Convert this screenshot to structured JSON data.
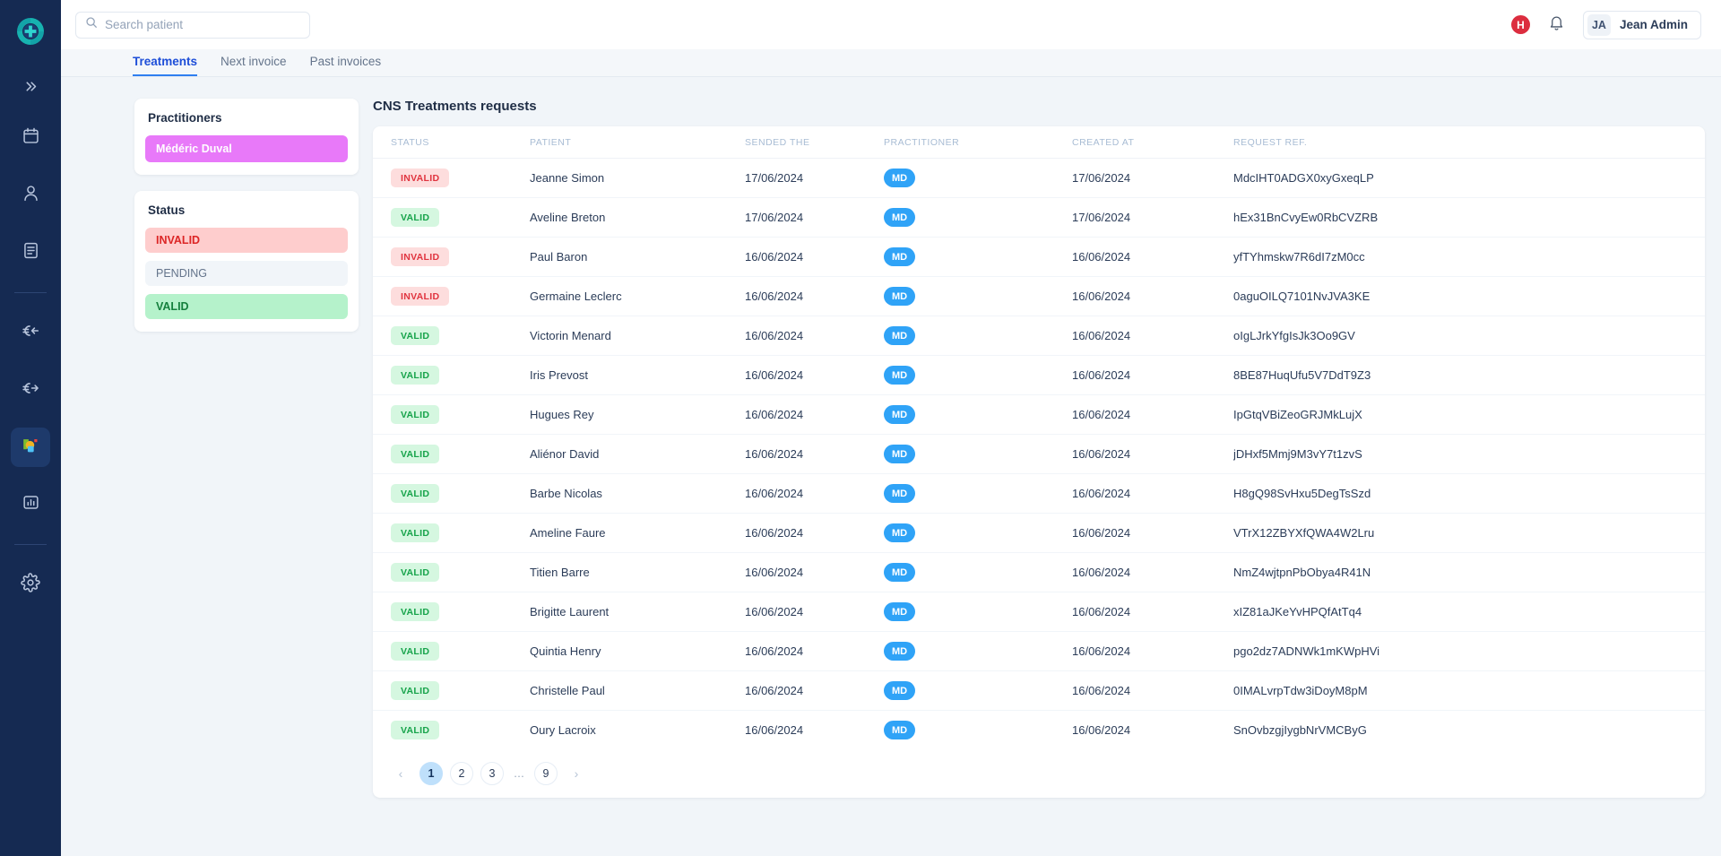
{
  "brand": {
    "logo_icon": "medical-cross-target-logo",
    "sidebar_bg": "#152a52"
  },
  "rail": {
    "collapse_icon": "double-chevron-right-icon",
    "items": [
      {
        "icon": "calendar-icon",
        "active": false
      },
      {
        "icon": "user-icon",
        "active": false
      },
      {
        "icon": "document-icon",
        "active": false
      },
      {
        "icon": "euro-incoming-icon",
        "active": false
      },
      {
        "icon": "euro-outgoing-icon",
        "active": false
      },
      {
        "icon": "cns-app-icon",
        "active": true
      },
      {
        "icon": "bar-chart-icon",
        "active": false
      },
      {
        "icon": "gear-icon",
        "active": false
      }
    ]
  },
  "topbar": {
    "search_placeholder": "Search patient",
    "search_value": "",
    "search_icon": "search-icon",
    "alert_count": "H",
    "bell_icon": "bell-icon",
    "user_initials": "JA",
    "user_name": "Jean Admin"
  },
  "tabs": [
    {
      "label": "Treatments",
      "active": true
    },
    {
      "label": "Next invoice",
      "active": false
    },
    {
      "label": "Past invoices",
      "active": false
    }
  ],
  "filters": {
    "practitioners_title": "Practitioners",
    "practitioners": [
      {
        "label": "Médéric Duval",
        "color": "#e879f9",
        "selected": true
      }
    ],
    "status_title": "Status",
    "statuses": [
      {
        "label": "INVALID",
        "color": "#fecdcd",
        "selected": true
      },
      {
        "label": "PENDING",
        "color": "#f1f5f9",
        "selected": false
      },
      {
        "label": "VALID",
        "color": "#b5f2cb",
        "selected": true
      }
    ]
  },
  "panel": {
    "title": "CNS Treatments requests",
    "columns": [
      "STATUS",
      "PATIENT",
      "SENDED THE",
      "PRACTITIONER",
      "CREATED AT",
      "REQUEST REF."
    ],
    "rows": [
      {
        "status": "INVALID",
        "patient": "Jeanne Simon",
        "sended_the": "17/06/2024",
        "practitioner": "MD",
        "created_at": "17/06/2024",
        "request_ref": "MdcIHT0ADGX0xyGxeqLP"
      },
      {
        "status": "VALID",
        "patient": "Aveline Breton",
        "sended_the": "17/06/2024",
        "practitioner": "MD",
        "created_at": "17/06/2024",
        "request_ref": "hEx31BnCvyEw0RbCVZRB"
      },
      {
        "status": "INVALID",
        "patient": "Paul Baron",
        "sended_the": "16/06/2024",
        "practitioner": "MD",
        "created_at": "16/06/2024",
        "request_ref": "yfTYhmskw7R6dI7zM0cc"
      },
      {
        "status": "INVALID",
        "patient": "Germaine Leclerc",
        "sended_the": "16/06/2024",
        "practitioner": "MD",
        "created_at": "16/06/2024",
        "request_ref": "0aguOILQ7101NvJVA3KE"
      },
      {
        "status": "VALID",
        "patient": "Victorin Menard",
        "sended_the": "16/06/2024",
        "practitioner": "MD",
        "created_at": "16/06/2024",
        "request_ref": "oIgLJrkYfgIsJk3Oo9GV"
      },
      {
        "status": "VALID",
        "patient": "Iris Prevost",
        "sended_the": "16/06/2024",
        "practitioner": "MD",
        "created_at": "16/06/2024",
        "request_ref": "8BE87HuqUfu5V7DdT9Z3"
      },
      {
        "status": "VALID",
        "patient": "Hugues Rey",
        "sended_the": "16/06/2024",
        "practitioner": "MD",
        "created_at": "16/06/2024",
        "request_ref": "IpGtqVBiZeoGRJMkLujX"
      },
      {
        "status": "VALID",
        "patient": "Aliénor David",
        "sended_the": "16/06/2024",
        "practitioner": "MD",
        "created_at": "16/06/2024",
        "request_ref": "jDHxf5Mmj9M3vY7t1zvS"
      },
      {
        "status": "VALID",
        "patient": "Barbe Nicolas",
        "sended_the": "16/06/2024",
        "practitioner": "MD",
        "created_at": "16/06/2024",
        "request_ref": "H8gQ98SvHxu5DegTsSzd"
      },
      {
        "status": "VALID",
        "patient": "Ameline Faure",
        "sended_the": "16/06/2024",
        "practitioner": "MD",
        "created_at": "16/06/2024",
        "request_ref": "VTrX12ZBYXfQWA4W2Lru"
      },
      {
        "status": "VALID",
        "patient": "Titien Barre",
        "sended_the": "16/06/2024",
        "practitioner": "MD",
        "created_at": "16/06/2024",
        "request_ref": "NmZ4wjtpnPbObya4R41N"
      },
      {
        "status": "VALID",
        "patient": "Brigitte Laurent",
        "sended_the": "16/06/2024",
        "practitioner": "MD",
        "created_at": "16/06/2024",
        "request_ref": "xIZ81aJKeYvHPQfAtTq4"
      },
      {
        "status": "VALID",
        "patient": "Quintia Henry",
        "sended_the": "16/06/2024",
        "practitioner": "MD",
        "created_at": "16/06/2024",
        "request_ref": "pgo2dz7ADNWk1mKWpHVi"
      },
      {
        "status": "VALID",
        "patient": "Christelle Paul",
        "sended_the": "16/06/2024",
        "practitioner": "MD",
        "created_at": "16/06/2024",
        "request_ref": "0IMALvrpTdw3iDoyM8pM"
      },
      {
        "status": "VALID",
        "patient": "Oury Lacroix",
        "sended_the": "16/06/2024",
        "practitioner": "MD",
        "created_at": "16/06/2024",
        "request_ref": "SnOvbzgjIygbNrVMCByG"
      }
    ]
  },
  "pagination": {
    "prev_icon": "chevron-left-icon",
    "next_icon": "chevron-right-icon",
    "pages": [
      "1",
      "2",
      "3",
      "…",
      "9"
    ],
    "current": "1"
  }
}
